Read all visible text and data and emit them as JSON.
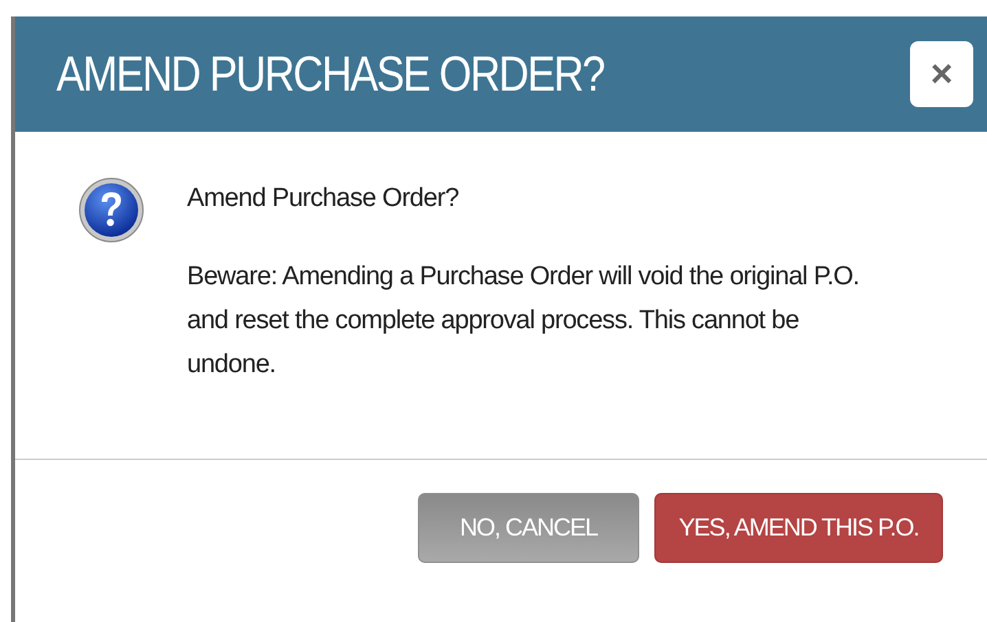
{
  "dialog": {
    "title": "AMEND PURCHASE ORDER?",
    "close": "×",
    "heading": "Amend Purchase Order?",
    "message": "Beware: Amending a Purchase Order will void the original P.O. and reset the complete approval process. This cannot be undone."
  },
  "buttons": [
    {
      "label": "NO, CANCEL",
      "kind": "secondary"
    },
    {
      "label": "YES, AMEND THIS P.O.",
      "kind": "primary"
    }
  ]
}
